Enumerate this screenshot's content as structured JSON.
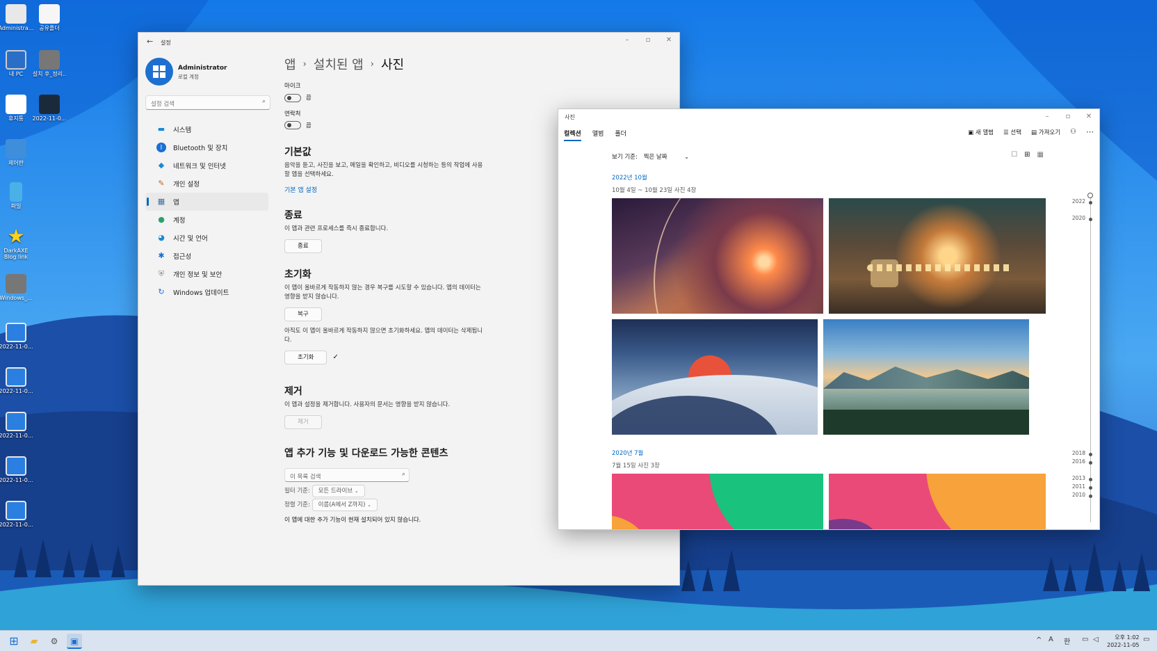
{
  "desktop": {
    "icons": [
      {
        "label": "Administra..."
      },
      {
        "label": "공유폴더"
      },
      {
        "label": "내 PC"
      },
      {
        "label": "설치 후_정리.."
      },
      {
        "label": "휴지통"
      },
      {
        "label": "2022-11-0..."
      },
      {
        "label": "제어판"
      },
      {
        "label": "파일"
      },
      {
        "label": "DarkAXE Blog link"
      },
      {
        "label": "Windows_..."
      },
      {
        "label": "2022-11-0..."
      },
      {
        "label": "2022-11-0..."
      },
      {
        "label": "2022-11-0..."
      },
      {
        "label": "2022-11-0..."
      },
      {
        "label": "2022-11-0..."
      }
    ]
  },
  "settings": {
    "title": "설정",
    "user_name": "Administrator",
    "user_type": "로컬 계정",
    "search_placeholder": "설정 검색",
    "nav": [
      {
        "label": "시스템",
        "icon": "monitor-icon"
      },
      {
        "label": "Bluetooth 및 장치",
        "icon": "bluetooth-icon"
      },
      {
        "label": "네트워크 및 인터넷",
        "icon": "wifi-icon"
      },
      {
        "label": "개인 설정",
        "icon": "brush-icon"
      },
      {
        "label": "앱",
        "icon": "apps-icon"
      },
      {
        "label": "계정",
        "icon": "person-icon"
      },
      {
        "label": "시간 및 언어",
        "icon": "globe-icon"
      },
      {
        "label": "접근성",
        "icon": "accessibility-icon"
      },
      {
        "label": "개인 정보 및 보안",
        "icon": "shield-icon"
      },
      {
        "label": "Windows 업데이트",
        "icon": "update-icon"
      }
    ],
    "breadcrumb": [
      "앱",
      "설치된 앱",
      "사진"
    ],
    "permissions": [
      {
        "label": "마이크",
        "state": "끔"
      },
      {
        "label": "연락처",
        "state": "끔"
      }
    ],
    "defaults_h": "기본값",
    "defaults_p": "음악을 듣고, 사진을 보고, 메일을 확인하고, 비디오를 시청하는 등의 작업에 사용할 앱을 선택하세요.",
    "defaults_link": "기본 앱 설정",
    "terminate_h": "종료",
    "terminate_p": "이 앱과 관련 프로세스를 즉시 종료합니다.",
    "terminate_btn": "종료",
    "reset_h": "초기화",
    "reset_p1": "이 앱이 올바르게 작동하지 않는 경우 복구를 시도할 수 있습니다. 앱의 데이터는 영향을 받지 않습니다.",
    "repair_btn": "복구",
    "reset_p2": "아직도 이 앱이 올바르게 작동하지 않으면 초기화하세요. 앱의 데이터는 삭제됩니다.",
    "reset_btn": "초기화",
    "remove_h": "제거",
    "remove_p": "이 앱과 설정을 제거합니다. 사용자의 문서는 영향을 받지 않습니다.",
    "remove_btn": "제거",
    "addons_h": "앱 추가 기능 및 다운로드 가능한 콘텐츠",
    "addons_search": "이 목록 검색",
    "filter_label": "필터 기준:",
    "filter_value": "모든 드라이브",
    "sort_label": "정렬 기준:",
    "sort_value": "이름(A에서 Z까지)",
    "addons_empty": "이 앱에 대한 추가 기능이 현재 설치되어 있지 않습니다."
  },
  "photos": {
    "title": "사진",
    "tabs": [
      "컬렉션",
      "앨범",
      "폴더"
    ],
    "toolbar": {
      "new_album": "새 앨범",
      "select": "선택",
      "import": "가져오기"
    },
    "view_label": "보기 기준:",
    "view_value": "찍은 날짜",
    "groups": [
      {
        "month": "2022년 10월",
        "sub": "10월 4일 ~ 10월 23일   사진 4장"
      },
      {
        "month": "2020년 7월",
        "sub": "7월 15일   사진 3장"
      }
    ],
    "timeline": [
      "2022",
      "2020",
      "2018",
      "2016",
      "2013",
      "2011",
      "2010"
    ]
  },
  "taskbar": {
    "ime": "A",
    "lang": "한",
    "time": "오후 1:02",
    "date": "2022-11-05"
  }
}
